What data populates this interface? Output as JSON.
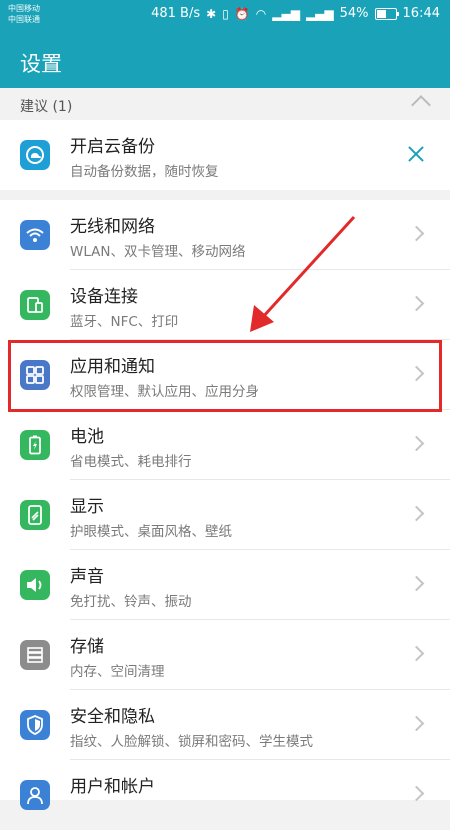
{
  "status_bar": {
    "carrier1": "中国移动",
    "carrier2": "中国联通",
    "speed": "481 B/s",
    "battery": "54%",
    "battery_level": 0.54,
    "time": "16:44"
  },
  "app_bar": {
    "title": "设置"
  },
  "suggestions": {
    "header": "建议 (1)",
    "item": {
      "title": "开启云备份",
      "subtitle": "自动备份数据，随时恢复",
      "icon": "cloud-backup-icon"
    }
  },
  "settings": {
    "items": [
      {
        "title": "无线和网络",
        "subtitle": "WLAN、双卡管理、移动网络",
        "icon": "wifi-icon",
        "color": "#3b82d6"
      },
      {
        "title": "设备连接",
        "subtitle": "蓝牙、NFC、打印",
        "icon": "device-connection-icon",
        "color": "#35b760"
      },
      {
        "title": "应用和通知",
        "subtitle": "权限管理、默认应用、应用分身",
        "icon": "apps-grid-icon",
        "color": "#4a78c8"
      },
      {
        "title": "电池",
        "subtitle": "省电模式、耗电排行",
        "icon": "battery-icon",
        "color": "#35b760"
      },
      {
        "title": "显示",
        "subtitle": "护眼模式、桌面风格、壁纸",
        "icon": "display-icon",
        "color": "#35b760"
      },
      {
        "title": "声音",
        "subtitle": "免打扰、铃声、振动",
        "icon": "speaker-icon",
        "color": "#35b760"
      },
      {
        "title": "存储",
        "subtitle": "内存、空间清理",
        "icon": "storage-icon",
        "color": "#8c8c8c"
      },
      {
        "title": "安全和隐私",
        "subtitle": "指纹、人脸解锁、锁屏和密码、学生模式",
        "icon": "shield-icon",
        "color": "#3b82d6"
      },
      {
        "title": "用户和帐户",
        "subtitle": "",
        "icon": "user-icon",
        "color": "#3b82d6"
      }
    ]
  },
  "colors": {
    "accent": "#1aa3b8",
    "highlight": "#e22a2a"
  }
}
